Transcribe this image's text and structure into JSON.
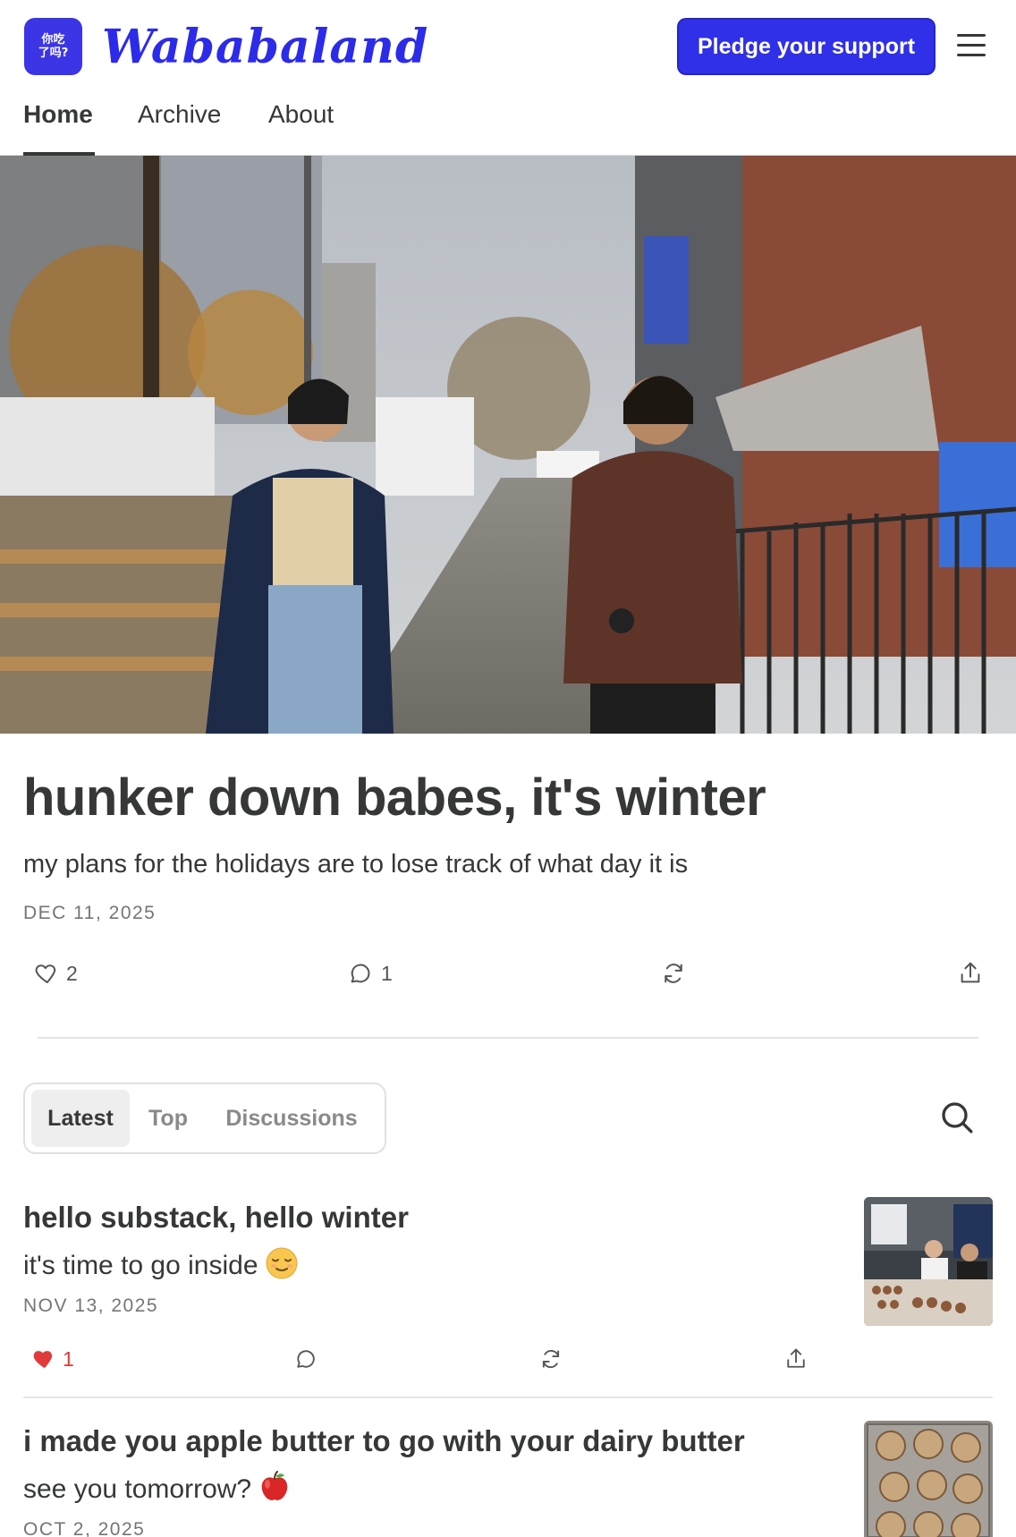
{
  "header": {
    "logo_text": "你吃\n了吗?",
    "brand": "Wababaland",
    "pledge_label": "Pledge your support"
  },
  "nav": {
    "tabs": [
      {
        "label": "Home",
        "active": true
      },
      {
        "label": "Archive",
        "active": false
      },
      {
        "label": "About",
        "active": false
      }
    ]
  },
  "featured": {
    "title": "hunker down babes, it's winter",
    "subtitle": "my plans for the holidays are to lose track of what day it is",
    "date": "DEC 11, 2025",
    "likes": "2",
    "comments": "1"
  },
  "filters": {
    "tabs": [
      {
        "label": "Latest",
        "active": true
      },
      {
        "label": "Top",
        "active": false
      },
      {
        "label": "Discussions",
        "active": false
      }
    ]
  },
  "posts": [
    {
      "title": "hello substack, hello winter",
      "subtitle": "it's time to go inside",
      "emoji": "relieved-face",
      "date": "NOV 13, 2025",
      "likes": "1",
      "liked": true
    },
    {
      "title": "i made you apple butter to go with your dairy butter",
      "subtitle": "see you tomorrow?",
      "emoji": "red-apple",
      "date": "OCT 2, 2025"
    }
  ],
  "colors": {
    "brand": "#2c2bea",
    "liked": "#e03a3a",
    "text": "#363737",
    "muted": "#757575"
  }
}
